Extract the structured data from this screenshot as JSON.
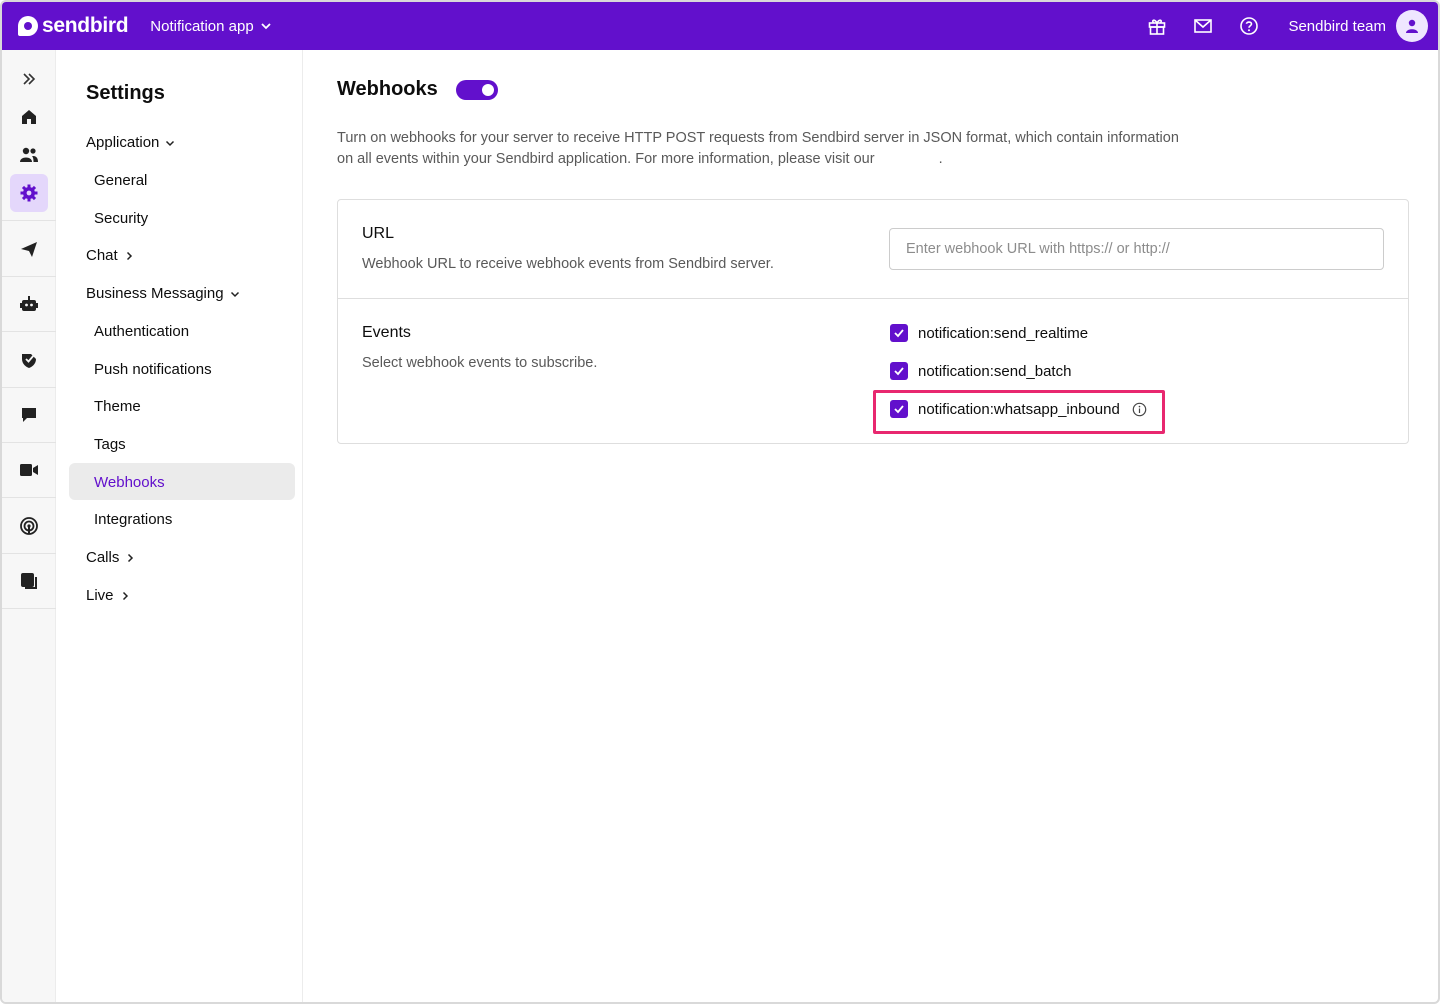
{
  "header": {
    "brand": "sendbird",
    "app_name": "Notification app",
    "team": "Sendbird team",
    "icons": [
      "gift-icon",
      "mail-icon",
      "help-icon",
      "user-icon"
    ]
  },
  "rail": {
    "icons": [
      "expand-icon",
      "home-icon",
      "users-icon",
      "settings-icon",
      "send-icon",
      "bot-icon",
      "moderation-icon",
      "chat-icon",
      "video-icon",
      "live-icon",
      "desk-icon"
    ]
  },
  "settings_nav": {
    "title": "Settings",
    "application": "Application",
    "general": "General",
    "security": "Security",
    "chat": "Chat",
    "business_messaging": "Business Messaging",
    "authentication": "Authentication",
    "push_notifications": "Push notifications",
    "theme": "Theme",
    "tags": "Tags",
    "webhooks": "Webhooks",
    "integrations": "Integrations",
    "calls": "Calls",
    "live": "Live"
  },
  "main": {
    "title": "Webhooks",
    "toggle_on": true,
    "intro_line1": "Turn on webhooks for your server to receive HTTP POST requests from Sendbird server in JSON format, which contain information",
    "intro_line2": "on all events within your Sendbird application. For more information, please visit our",
    "intro_end": ".",
    "url": {
      "title": "URL",
      "description": "Webhook URL to receive webhook events from Sendbird server.",
      "value": "",
      "placeholder": "Enter webhook URL with https:// or http://"
    },
    "events": {
      "title": "Events",
      "description": "Select webhook events to subscribe.",
      "items": [
        {
          "label": "notification:send_realtime",
          "checked": true
        },
        {
          "label": "notification:send_batch",
          "checked": true
        },
        {
          "label": "notification:whatsapp_inbound",
          "checked": true
        }
      ]
    }
  },
  "colors": {
    "brand": "#6210cc",
    "highlight": "#e8286f"
  }
}
